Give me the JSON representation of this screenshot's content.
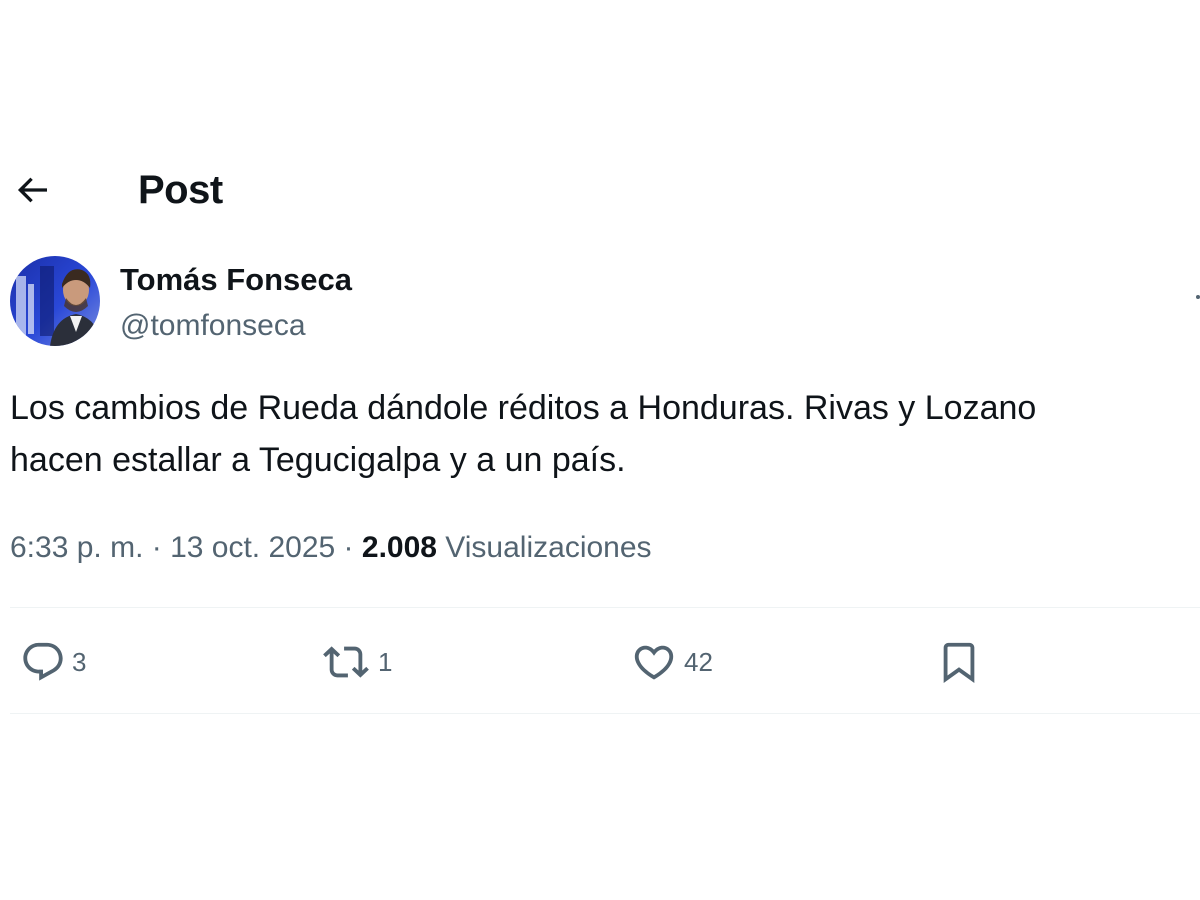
{
  "header": {
    "back_icon": "arrow-left-icon",
    "title": "Post"
  },
  "author": {
    "name": "Tomás Fonseca",
    "handle": "@tomfonseca"
  },
  "post": {
    "text_line1": "Los cambios de Rueda dándole réditos a Honduras. Rivas y Lozano",
    "text_line2": "hacen estallar a Tegucigalpa y a un país."
  },
  "meta": {
    "time": "6:33 p. m.",
    "separator1": " · ",
    "date": "13 oct. 2025",
    "separator2": " · ",
    "views_count": "2.008",
    "views_label": " Visualizaciones"
  },
  "actions": {
    "reply": {
      "icon": "reply-icon",
      "count": "3"
    },
    "repost": {
      "icon": "repost-icon",
      "count": "1"
    },
    "like": {
      "icon": "heart-icon",
      "count": "42"
    },
    "bookmark": {
      "icon": "bookmark-icon"
    }
  },
  "colors": {
    "text": "#0f1419",
    "secondary": "#536471",
    "divider": "#eff3f4"
  }
}
